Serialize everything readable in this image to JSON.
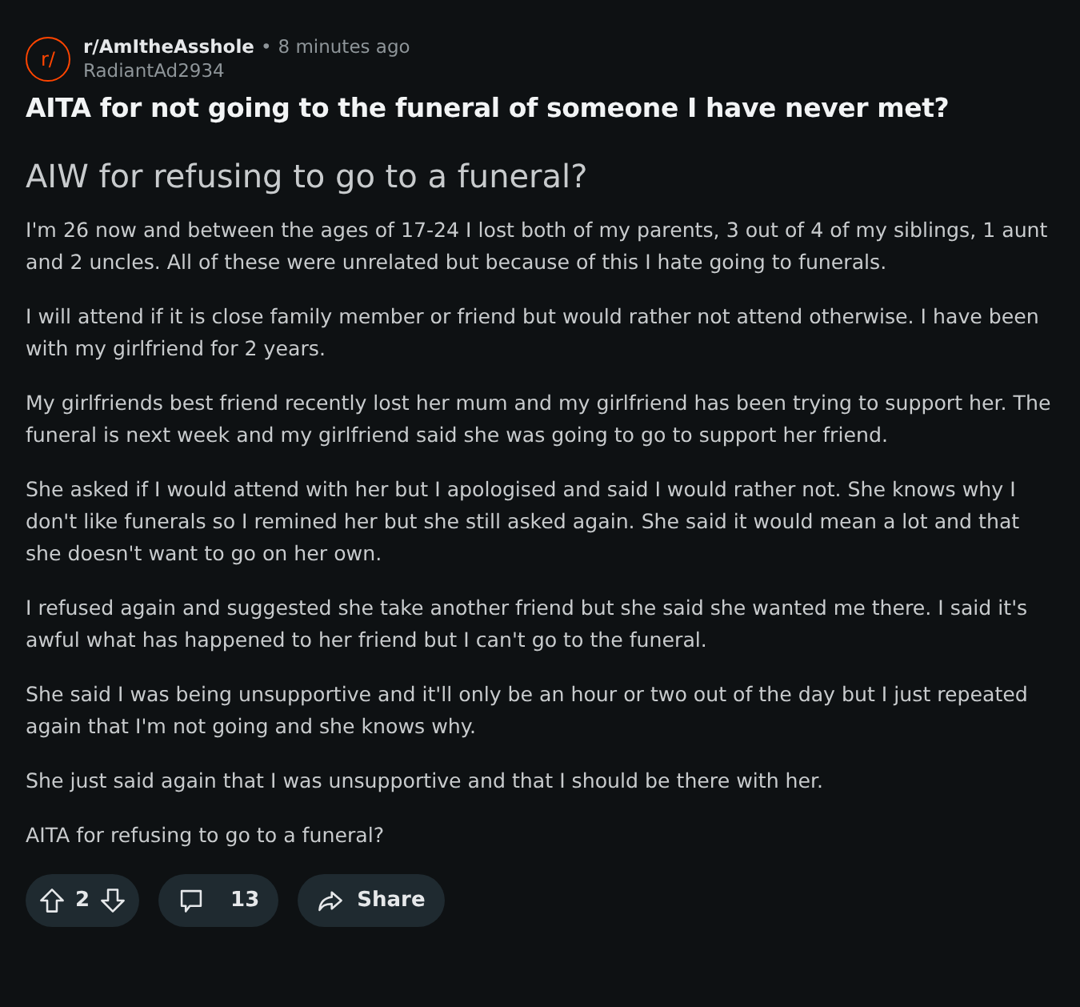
{
  "post": {
    "avatar": "r/",
    "subreddit": "r/AmItheAsshole",
    "separator": "•",
    "time": "8 minutes ago",
    "author": "RadiantAd2934",
    "title": "AITA for not going to the funeral of someone I have never met?"
  },
  "body": {
    "heading": "AIW for refusing to go to a funeral?",
    "paragraphs": [
      "I'm 26 now and between the ages of 17-24 I lost both of my parents, 3 out of 4 of my siblings, 1 aunt and 2 uncles. All of these were unrelated but because of this I hate going to funerals.",
      "I will attend if it is close family member or friend but would rather not attend otherwise. I have been with my girlfriend for 2 years.",
      "My girlfriends best friend recently lost her mum and my girlfriend has been trying to support her. The funeral is next week and my girlfriend said she was going to go to support her friend.",
      "She asked if I would attend with her but I apologised and said I would rather not. She knows why I don't like funerals so I remined her but she still asked again. She said it would mean a lot and that she doesn't want to go on her own.",
      "I refused again and suggested she take another friend but she said she wanted me there. I said it's awful what has happened to her friend but I can't go to the funeral.",
      "She said I was being unsupportive and it'll only be an hour or two out of the day but I just repeated again that I'm not going and she knows why.",
      "She just said again that I was unsupportive and that I should be there with her.",
      "AITA for refusing to go to a funeral?"
    ]
  },
  "actions": {
    "votes": "2",
    "comments": "13",
    "share": "Share"
  }
}
